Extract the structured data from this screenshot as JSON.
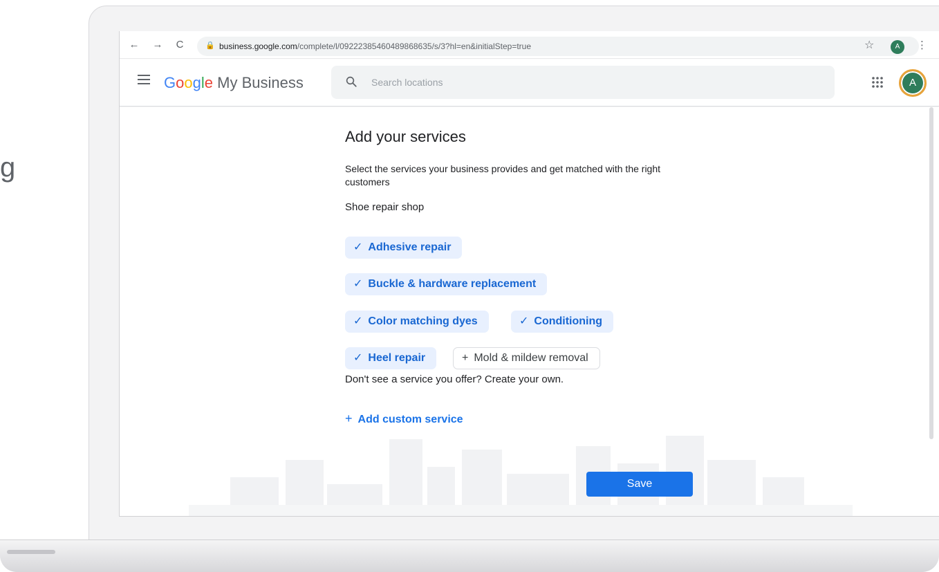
{
  "side_mark": "g",
  "browser": {
    "url_host": "business.google.com",
    "url_path": "/complete/l/09222385460489868635/s/3?hl=en&initialStep=true",
    "profile_initial": "A",
    "back_glyph": "←",
    "forward_glyph": "→",
    "reload_glyph": "C",
    "star_glyph": "☆",
    "kebab_glyph": "⋮",
    "lock_glyph": "🔒"
  },
  "app": {
    "brand_google": [
      "G",
      "o",
      "o",
      "g",
      "l",
      "e"
    ],
    "brand_product": " My Business",
    "search_placeholder": "Search locations",
    "avatar_initial": "A",
    "colors": {
      "blue": "#4285f4",
      "red": "#ea4335",
      "yellow": "#fbbc05",
      "green": "#34a853",
      "primary": "#1a73e8",
      "chip_selected_bg": "#e8f0fe"
    }
  },
  "main": {
    "title": "Add your services",
    "description": "Select the services your business provides and get matched with the right customers",
    "category": "Shoe repair shop",
    "selected_mark": "✓",
    "unselected_mark": "+",
    "chips": [
      {
        "label": "Adhesive repair",
        "selected": true
      },
      {
        "label": "Buckle & hardware replacement",
        "selected": true
      },
      {
        "label": "Color matching dyes",
        "selected": true
      },
      {
        "label": "Conditioning",
        "selected": true
      },
      {
        "label": "Heel repair",
        "selected": true
      },
      {
        "label": "Mold & mildew removal",
        "selected": false
      }
    ],
    "prompt": "Don't see a service you offer? Create your own.",
    "add_custom_plus": "+",
    "add_custom_label": "Add custom service",
    "save_label": "Save"
  }
}
